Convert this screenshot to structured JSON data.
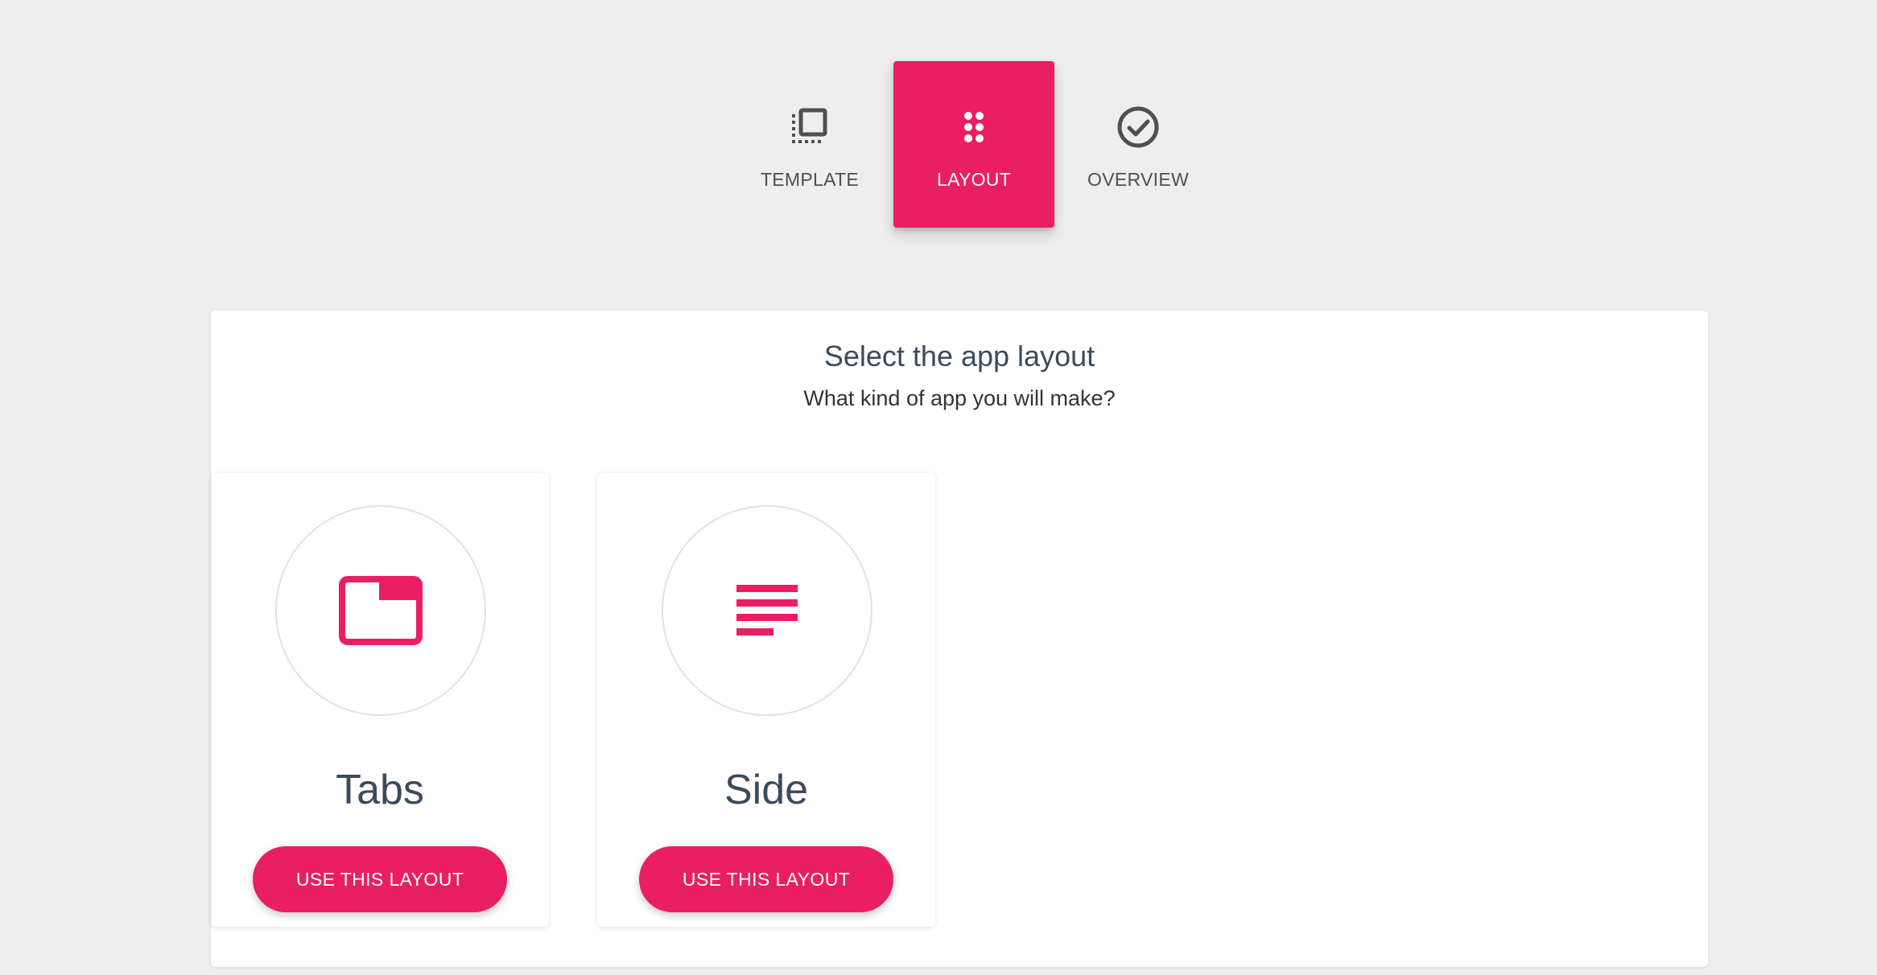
{
  "stepper": {
    "steps": [
      {
        "label": "TEMPLATE",
        "icon": "template-icon",
        "active": false
      },
      {
        "label": "LAYOUT",
        "icon": "drag-dots-icon",
        "active": true
      },
      {
        "label": "OVERVIEW",
        "icon": "check-circle-icon",
        "active": false
      }
    ]
  },
  "panel": {
    "title": "Select the app layout",
    "subtitle": "What kind of app you will make?"
  },
  "layouts": [
    {
      "name": "Tabs",
      "icon": "tab-icon",
      "button_label": "USE THIS LAYOUT"
    },
    {
      "name": "Side",
      "icon": "side-menu-icon",
      "button_label": "USE THIS LAYOUT"
    }
  ],
  "colors": {
    "accent": "#e91e63",
    "background": "#eeeeee",
    "card": "#ffffff",
    "title_text": "#3d4a5c",
    "inactive_step": "#4f4f4f"
  }
}
